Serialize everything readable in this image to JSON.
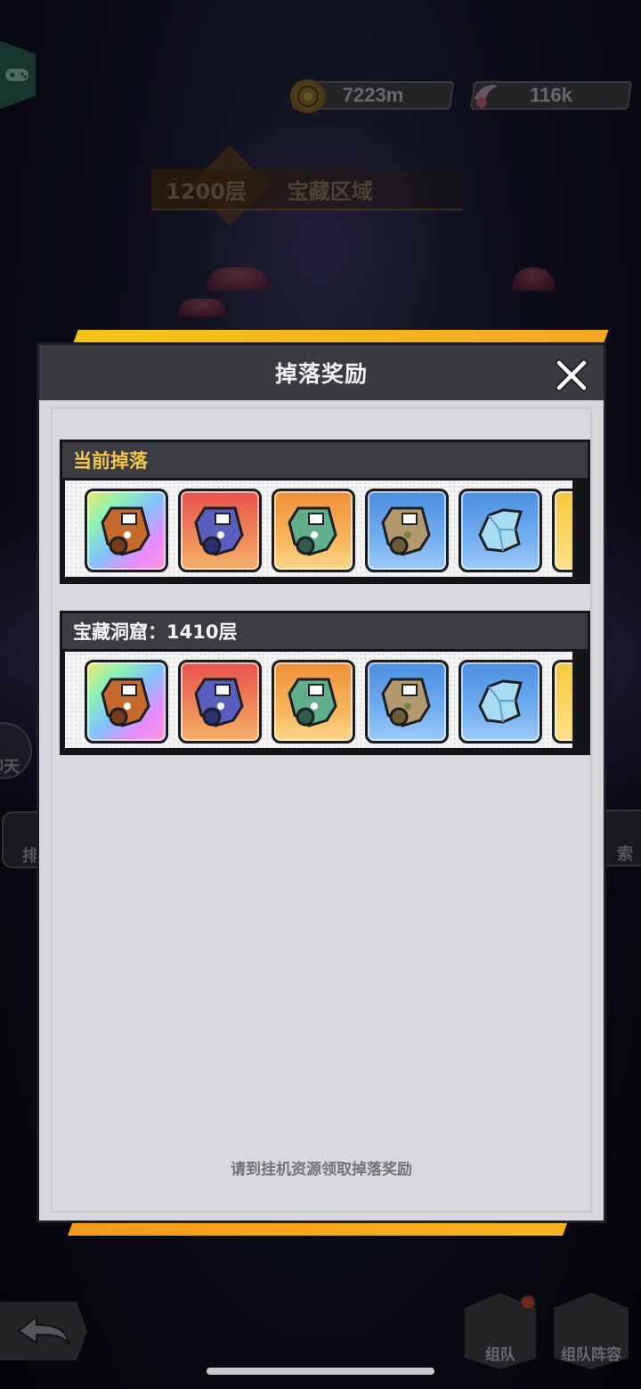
{
  "hud": {
    "coins": {
      "icon": "coin-icon",
      "value": "7223m"
    },
    "gems": {
      "icon": "wing-gem-icon",
      "value": "116k"
    },
    "floor": "1200层",
    "area": "宝藏区域"
  },
  "side_buttons": {
    "chat": "聊天",
    "rank": "排",
    "explore": "索"
  },
  "bottom_nav": {
    "team": "组队",
    "team_lineup": "组队阵容"
  },
  "modal": {
    "title": "掉落奖励",
    "close_icon": "close-x-icon",
    "sections": [
      {
        "heading": "当前掉落",
        "items": [
          {
            "icon": "cloak-scroll-icon",
            "rarity": "rainbow"
          },
          {
            "icon": "cloak-scroll-icon",
            "rarity": "red"
          },
          {
            "icon": "cloak-scroll-icon",
            "rarity": "orange"
          },
          {
            "icon": "cloak-scroll-icon",
            "rarity": "blue"
          },
          {
            "icon": "crystal-shard-icon",
            "rarity": "blue"
          },
          {
            "icon": "gold-item-icon",
            "rarity": "yellow"
          }
        ]
      },
      {
        "heading": "宝藏洞窟：1410层",
        "items": [
          {
            "icon": "cloak-scroll-icon",
            "rarity": "rainbow"
          },
          {
            "icon": "cloak-scroll-icon",
            "rarity": "red"
          },
          {
            "icon": "cloak-scroll-icon",
            "rarity": "orange"
          },
          {
            "icon": "cloak-scroll-icon",
            "rarity": "blue"
          },
          {
            "icon": "crystal-shard-icon",
            "rarity": "blue"
          },
          {
            "icon": "gold-item-icon",
            "rarity": "yellow"
          }
        ]
      }
    ],
    "hint": "请到挂机资源领取掉落奖励"
  }
}
